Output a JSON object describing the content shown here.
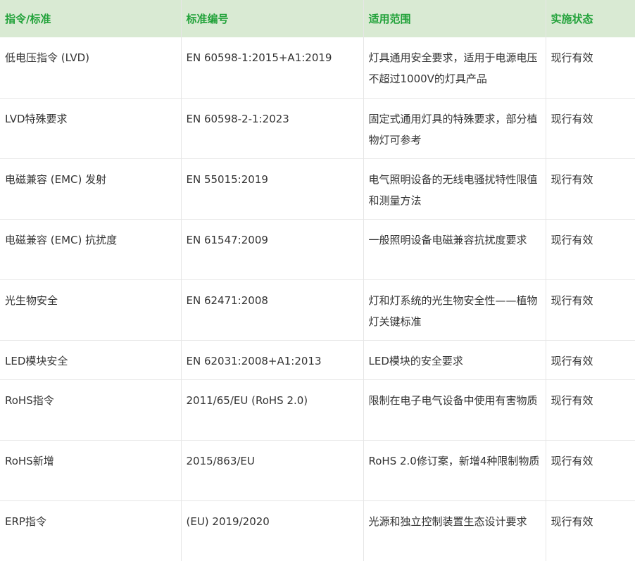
{
  "headers": [
    "指令/标准",
    "标准编号",
    "适用范围",
    "实施状态"
  ],
  "rows": [
    [
      "低电压指令 (LVD)",
      "EN 60598-1:2015+A1:2019",
      "灯具通用安全要求，适用于电源电压不超过1000V的灯具产品",
      "现行有效"
    ],
    [
      "LVD特殊要求",
      "EN 60598-2-1:2023",
      "固定式通用灯具的特殊要求，部分植物灯可参考",
      "现行有效"
    ],
    [
      "电磁兼容 (EMC) 发射",
      "EN 55015:2019",
      "电气照明设备的无线电骚扰特性限值和测量方法",
      "现行有效"
    ],
    [
      "电磁兼容 (EMC) 抗扰度",
      "EN 61547:2009",
      "一般照明设备电磁兼容抗扰度要求",
      "现行有效"
    ],
    [
      "光生物安全",
      "EN 62471:2008",
      "灯和灯系统的光生物安全性——植物灯关键标准",
      "现行有效"
    ],
    [
      "LED模块安全",
      "EN 62031:2008+A1:2013",
      "LED模块的安全要求",
      "现行有效"
    ],
    [
      "RoHS指令",
      "2011/65/EU (RoHS 2.0)",
      "限制在电子电气设备中使用有害物质",
      "现行有效"
    ],
    [
      "RoHS新增",
      "2015/863/EU",
      "RoHS 2.0修订案，新增4种限制物质",
      "现行有效"
    ],
    [
      "ERP指令",
      "(EU) 2019/2020",
      "光源和独立控制装置生态设计要求",
      "现行有效"
    ]
  ],
  "colors": {
    "header_bg": "#d9ead3",
    "header_text": "#22a23a",
    "body_text": "#333333",
    "border": "#e6e6e6"
  }
}
